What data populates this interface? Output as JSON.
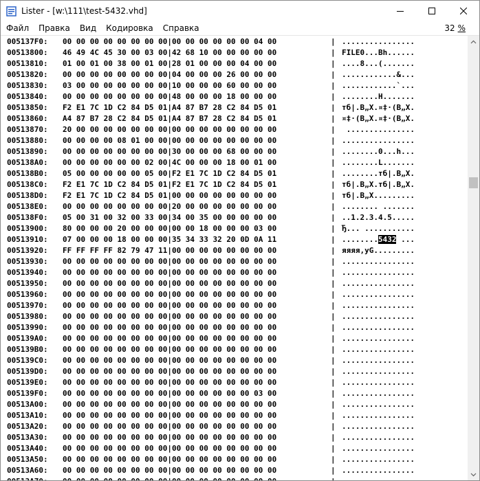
{
  "window": {
    "title": "Lister - [w:\\111\\test-5432.vhd]"
  },
  "menu": {
    "items": [
      "Файл",
      "Правка",
      "Вид",
      "Кодировка",
      "Справка"
    ],
    "zoom_value": "32",
    "zoom_unit": "%"
  },
  "highlight": "5432",
  "rows": [
    {
      "off": "005137F0:",
      "hex": "00 00 00 00 00 00 00 00|00 00 00 00 00 00 04 00",
      "asc": "................"
    },
    {
      "off": "00513800:",
      "hex": "46 49 4C 45 30 00 03 00|42 68 10 00 00 00 00 00",
      "asc": "FILE0...Bh......"
    },
    {
      "off": "00513810:",
      "hex": "01 00 01 00 38 00 01 00|28 01 00 00 00 04 00 00",
      "asc": "....8...(......."
    },
    {
      "off": "00513820:",
      "hex": "00 00 00 00 00 00 00 00|04 00 00 00 26 00 00 00",
      "asc": "............&..."
    },
    {
      "off": "00513830:",
      "hex": "03 00 00 00 00 00 00 00|10 00 00 00 60 00 00 00",
      "asc": "............`..."
    },
    {
      "off": "00513840:",
      "hex": "00 00 00 00 00 00 00 00|48 00 00 00 18 00 00 00",
      "asc": "........H......."
    },
    {
      "off": "00513850:",
      "hex": "F2 E1 7C 1D C2 84 D5 01|A4 87 B7 28 C2 84 D5 01",
      "asc": "тб|.В„Х.¤‡·(В„Х."
    },
    {
      "off": "00513860:",
      "hex": "A4 87 B7 28 C2 84 D5 01|A4 87 B7 28 C2 84 D5 01",
      "asc": "¤‡·(В„Х.¤‡·(В„Х."
    },
    {
      "off": "00513870:",
      "hex": "20 00 00 00 00 00 00 00|00 00 00 00 00 00 00 00",
      "asc": " ..............."
    },
    {
      "off": "00513880:",
      "hex": "00 00 00 00 08 01 00 00|00 00 00 00 00 00 00 00",
      "asc": "................"
    },
    {
      "off": "00513890:",
      "hex": "00 00 00 00 00 00 00 00|30 00 00 00 68 00 00 00",
      "asc": "........0...h..."
    },
    {
      "off": "005138A0:",
      "hex": "00 00 00 00 00 00 02 00|4C 00 00 00 18 00 01 00",
      "asc": "........L......."
    },
    {
      "off": "005138B0:",
      "hex": "05 00 00 00 00 00 05 00|F2 E1 7C 1D C2 84 D5 01",
      "asc": "........тб|.В„Х."
    },
    {
      "off": "005138C0:",
      "hex": "F2 E1 7C 1D C2 84 D5 01|F2 E1 7C 1D C2 84 D5 01",
      "asc": "тб|.В„Х.тб|.В„Х."
    },
    {
      "off": "005138D0:",
      "hex": "F2 E1 7C 1D C2 84 D5 01|00 00 00 00 00 00 00 00",
      "asc": "тб|.В„Х........."
    },
    {
      "off": "005138E0:",
      "hex": "00 00 00 00 00 00 00 00|20 00 00 00 00 00 00 00",
      "asc": "........ ......."
    },
    {
      "off": "005138F0:",
      "hex": "05 00 31 00 32 00 33 00|34 00 35 00 00 00 00 00",
      "asc": "..1.2.3.4.5....."
    },
    {
      "off": "00513900:",
      "hex": "80 00 00 00 20 00 00 00|00 00 18 00 00 00 03 00",
      "asc": "Ђ... ..........."
    },
    {
      "off": "00513910:",
      "hex": "07 00 00 00 18 00 00 00|35 34 33 32 20 0D 0A 11",
      "asc_pre": "........",
      "asc_post": " ..."
    },
    {
      "off": "00513920:",
      "hex": "FF FF FF FF 82 79 47 11|00 00 00 00 00 00 00 00",
      "asc": "яяяя‚yG........."
    },
    {
      "off": "00513930:",
      "hex": "00 00 00 00 00 00 00 00|00 00 00 00 00 00 00 00",
      "asc": "................"
    },
    {
      "off": "00513940:",
      "hex": "00 00 00 00 00 00 00 00|00 00 00 00 00 00 00 00",
      "asc": "................"
    },
    {
      "off": "00513950:",
      "hex": "00 00 00 00 00 00 00 00|00 00 00 00 00 00 00 00",
      "asc": "................"
    },
    {
      "off": "00513960:",
      "hex": "00 00 00 00 00 00 00 00|00 00 00 00 00 00 00 00",
      "asc": "................"
    },
    {
      "off": "00513970:",
      "hex": "00 00 00 00 00 00 00 00|00 00 00 00 00 00 00 00",
      "asc": "................"
    },
    {
      "off": "00513980:",
      "hex": "00 00 00 00 00 00 00 00|00 00 00 00 00 00 00 00",
      "asc": "................"
    },
    {
      "off": "00513990:",
      "hex": "00 00 00 00 00 00 00 00|00 00 00 00 00 00 00 00",
      "asc": "................"
    },
    {
      "off": "005139A0:",
      "hex": "00 00 00 00 00 00 00 00|00 00 00 00 00 00 00 00",
      "asc": "................"
    },
    {
      "off": "005139B0:",
      "hex": "00 00 00 00 00 00 00 00|00 00 00 00 00 00 00 00",
      "asc": "................"
    },
    {
      "off": "005139C0:",
      "hex": "00 00 00 00 00 00 00 00|00 00 00 00 00 00 00 00",
      "asc": "................"
    },
    {
      "off": "005139D0:",
      "hex": "00 00 00 00 00 00 00 00|00 00 00 00 00 00 00 00",
      "asc": "................"
    },
    {
      "off": "005139E0:",
      "hex": "00 00 00 00 00 00 00 00|00 00 00 00 00 00 00 00",
      "asc": "................"
    },
    {
      "off": "005139F0:",
      "hex": "00 00 00 00 00 00 00 00|00 00 00 00 00 00 03 00",
      "asc": "................"
    },
    {
      "off": "00513A00:",
      "hex": "00 00 00 00 00 00 00 00|00 00 00 00 00 00 00 00",
      "asc": "................"
    },
    {
      "off": "00513A10:",
      "hex": "00 00 00 00 00 00 00 00|00 00 00 00 00 00 00 00",
      "asc": "................"
    },
    {
      "off": "00513A20:",
      "hex": "00 00 00 00 00 00 00 00|00 00 00 00 00 00 00 00",
      "asc": "................"
    },
    {
      "off": "00513A30:",
      "hex": "00 00 00 00 00 00 00 00|00 00 00 00 00 00 00 00",
      "asc": "................"
    },
    {
      "off": "00513A40:",
      "hex": "00 00 00 00 00 00 00 00|00 00 00 00 00 00 00 00",
      "asc": "................"
    },
    {
      "off": "00513A50:",
      "hex": "00 00 00 00 00 00 00 00|00 00 00 00 00 00 00 00",
      "asc": "................"
    },
    {
      "off": "00513A60:",
      "hex": "00 00 00 00 00 00 00 00|00 00 00 00 00 00 00 00",
      "asc": "................"
    },
    {
      "off": "00513A70:",
      "hex": "00 00 00 00 00 00 00 00|00 00 00 00 00 00 00 00",
      "asc": "................"
    }
  ]
}
